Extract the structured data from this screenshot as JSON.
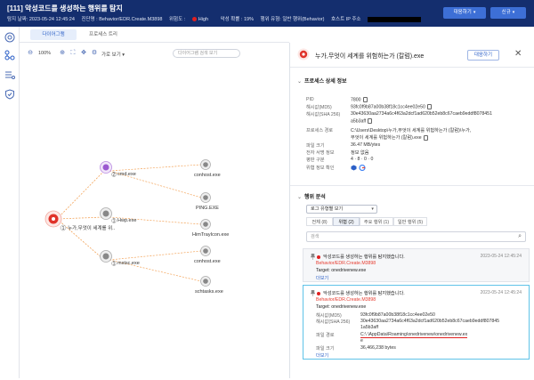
{
  "header": {
    "title": "[111] 악성코드를 생성하는 행위를 탐지",
    "detect_date_label": "탐지 날짜: 2023-05-24 12:45:24",
    "detection_label": "진단명 : Behavior/EDR.Create.M3898",
    "severity_label": "위험도 :",
    "severity_value": "High",
    "malicious_prob": "악성 확률 : 19%",
    "behavior_type": "행위 유형: 일반 행위(Behavior)",
    "host_ip_label": "호스트 IP 주소",
    "respond_button": "대응하기",
    "new_button": "신규",
    "caret": "▾"
  },
  "tabs": [
    "다이어그램",
    "프로세스 트리"
  ],
  "graph_toolbar": {
    "zoom": "100%",
    "layout_label": "가로 보기",
    "search_placeholder": "다이어그램 검색 보기"
  },
  "graph": {
    "nodes": [
      {
        "label": "누가,무엇이 세계를 위..",
        "badge": "1"
      },
      {
        "label": "cmd.exe",
        "badge": "2"
      },
      {
        "label": "Hwp.exe",
        "badge": "1"
      },
      {
        "label": "mstsc.exe",
        "badge": "1"
      },
      {
        "label": "conhost.exe",
        "badge": ""
      },
      {
        "label": "PING.EXE",
        "badge": ""
      },
      {
        "label": "HimTrayIcon.exe",
        "badge": ""
      },
      {
        "label": "conhost.exe",
        "badge": ""
      },
      {
        "label": "schtasks.exe",
        "badge": ""
      }
    ]
  },
  "panel": {
    "title": "누가,무엇이 세계를 위험하는가 (칼럼).exe",
    "respond_button": "대응하기",
    "close": "✕",
    "process_section": "프로세스 상세 정보",
    "fields": [
      {
        "label": "PID",
        "value": "7800"
      },
      {
        "label": "해시값(MD5)",
        "value": "93fc0f9b87a00b38f18c1cc4ee02e50"
      },
      {
        "label": "해시값(SHA 256)",
        "value": "30e43630aa2734a6c4f63a2dcf1ad620b52eb8c67caeb9eddf8078451"
      },
      {
        "label": "",
        "value": "a5b3aff"
      },
      {
        "label": "프로세스 경로",
        "value": "C:\\Users\\Desktop\\누가,무엇이 세계를 위험하는가 (칼럼)\\누가,"
      },
      {
        "label": "",
        "value": "무엇이 세계를 위험하는가 (칼럼).exe"
      },
      {
        "label": "파일 크기",
        "value": "36.47 MB/ytes"
      },
      {
        "label": "전자 서명 정보",
        "value": "정보 없음"
      },
      {
        "label": "평판 구분",
        "value": "4 · 8 · 0 · 0"
      },
      {
        "label": "위협 정보 확인",
        "value": ""
      }
    ],
    "behavior_section": "행위 분석",
    "log_select": "로그 유형별 보기",
    "filter_tabs": [
      "전체 (8)",
      "위협 (2)",
      "주요 행위 (1)",
      "일반 행위 (5)"
    ],
    "search_placeholder": "검색",
    "cards": [
      {
        "title": "악성코드를 생성하는 행위를 탐지했습니다.",
        "time": "2023-05-24 12:45:24",
        "rule": "Behavior/EDR.Create.M3898",
        "target": "Target: onedrivenew.exe",
        "more": "더보기"
      },
      {
        "title": "악성코드를 생성하는 행위를 탐지했습니다.",
        "time": "2023-05-24 12:45:24",
        "rule": "Behavior/EDR.Create.M3898",
        "target": "Target: onedrivenew.exe",
        "details": [
          {
            "label": "해시값(MD5)",
            "value": "93fc0f9b87a00b38f18c1cc4ee02e50"
          },
          {
            "label": "해시값(SHA 256)",
            "value": "30e43630aa2734a6c4f63a2dcf1ad620b52eb8c67caeb9eddf807845"
          },
          {
            "label": "",
            "value": "1a5b3aff"
          },
          {
            "label": "파일 경로",
            "value": "C:\\ \\AppData\\Roaming\\onedrivenew\\onedrivenew.ex"
          },
          {
            "label": "",
            "value": "e"
          },
          {
            "label": "파일 크기",
            "value": "36,466,238 bytes"
          }
        ],
        "more": "더보기"
      }
    ]
  },
  "colors": {
    "header_bg": "#142e6e",
    "accent": "#2b5fc7",
    "danger": "#e02020",
    "rule_text": "#e63b2e",
    "selected_border": "#5fc3e8"
  }
}
